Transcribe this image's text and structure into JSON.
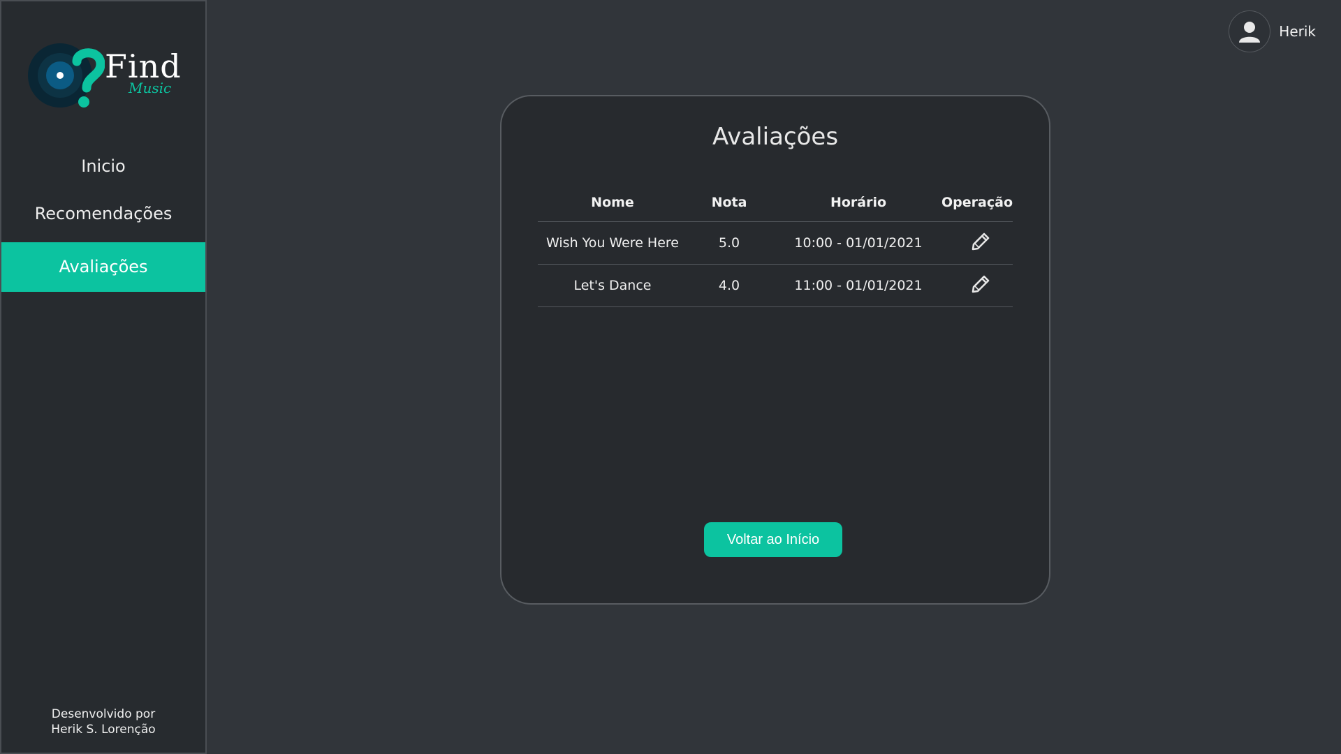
{
  "brand": {
    "name": "Find",
    "sub": "Music",
    "colors": {
      "accent": "#0cc3a0",
      "logo_disc": "#0a2634",
      "logo_center": "#0b5b84"
    }
  },
  "sidebar": {
    "items": [
      {
        "label": "Inicio",
        "active": false
      },
      {
        "label": "Recomendações",
        "active": false
      },
      {
        "label": "Avaliações",
        "active": true
      }
    ],
    "credit_line1": "Desenvolvido por",
    "credit_line2": "Herik S. Lorenção"
  },
  "user": {
    "name": "Herik",
    "icon": "user-icon"
  },
  "card": {
    "title": "Avaliações",
    "table": {
      "headers": [
        "Nome",
        "Nota",
        "Horário",
        "Operação"
      ],
      "rows": [
        {
          "nome": "Wish You Were Here",
          "nota": "5.0",
          "horario": "10:00 - 01/01/2021",
          "operacao_icon": "pencil-icon"
        },
        {
          "nome": "Let's Dance",
          "nota": "4.0",
          "horario": "11:00 - 01/01/2021",
          "operacao_icon": "pencil-icon"
        }
      ]
    },
    "back_button": "Voltar ao Início"
  }
}
